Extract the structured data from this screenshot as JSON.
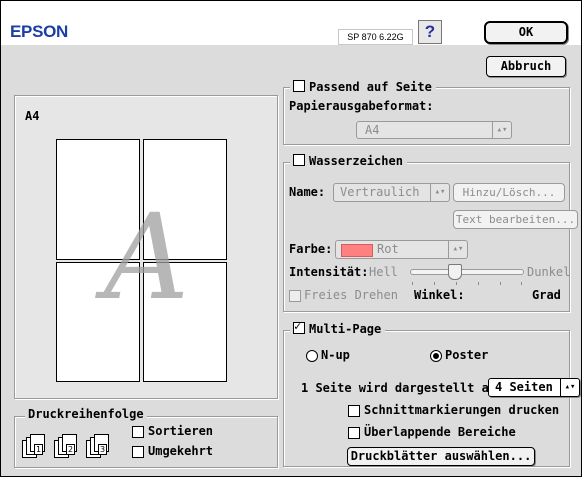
{
  "header": {
    "brand": "EPSON",
    "version": "SP 870 6.22G",
    "help_label": "?",
    "ok_label": "OK",
    "cancel_label": "Abbruch"
  },
  "preview": {
    "paper_label": "A4",
    "watermark_letter": "A"
  },
  "fit_to_page": {
    "label": "Passend auf Seite",
    "checked": false,
    "output_format_label": "Papierausgabeformat:",
    "output_format_value": "A4"
  },
  "watermark": {
    "label": "Wasserzeichen",
    "checked": false,
    "name_label": "Name:",
    "name_value": "Vertraulich",
    "add_delete_label": "Hinzu/Lösch...",
    "edit_text_label": "Text bearbeiten...",
    "color_label": "Farbe:",
    "color_value": "Rot",
    "color_swatch": "#ff8080",
    "intensity_label": "Intensität:",
    "light_label": "Hell",
    "dark_label": "Dunkel",
    "intensity_level": 0.4,
    "free_rotate_label": "Freies Drehen",
    "angle_label": "Winkel:",
    "degree_label": "Grad"
  },
  "multi_page": {
    "label": "Multi-Page",
    "checked": true,
    "nup_label": "N-up",
    "poster_label": "Poster",
    "selected": "Poster",
    "shown_on_label": "1 Seite wird dargestellt auf",
    "pages_value": "4 Seiten",
    "cut_marks_label": "Schnittmarkierungen drucken",
    "overlap_label": "Überlappende Bereiche",
    "select_sheets_label": "Druckblätter auswählen..."
  },
  "print_order": {
    "label": "Druckreihenfolge",
    "sort_label": "Sortieren",
    "reverse_label": "Umgekehrt",
    "icon_numbers": [
      "1",
      "2",
      "3"
    ]
  }
}
